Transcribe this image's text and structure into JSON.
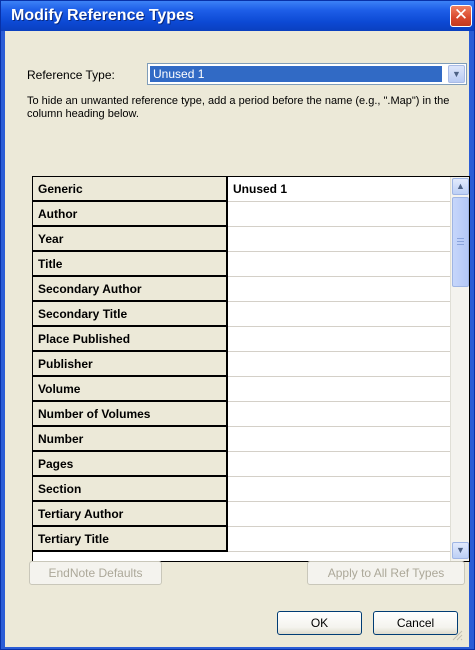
{
  "window": {
    "title": "Modify Reference Types",
    "close_glyph": "✕"
  },
  "reference_type": {
    "label": "Reference Type:",
    "selected": "Unused 1",
    "arrow_glyph": "▼"
  },
  "instructions": "To hide an unwanted reference type, add a period before the name (e.g., \".Map\") in the column heading below.",
  "fields": [
    {
      "label": "Generic",
      "value": "Unused 1"
    },
    {
      "label": "Author",
      "value": ""
    },
    {
      "label": "Year",
      "value": ""
    },
    {
      "label": "Title",
      "value": ""
    },
    {
      "label": "Secondary Author",
      "value": ""
    },
    {
      "label": "Secondary Title",
      "value": ""
    },
    {
      "label": "Place Published",
      "value": ""
    },
    {
      "label": "Publisher",
      "value": ""
    },
    {
      "label": "Volume",
      "value": ""
    },
    {
      "label": "Number of Volumes",
      "value": ""
    },
    {
      "label": "Number",
      "value": ""
    },
    {
      "label": "Pages",
      "value": ""
    },
    {
      "label": "Section",
      "value": ""
    },
    {
      "label": "Tertiary Author",
      "value": ""
    },
    {
      "label": "Tertiary Title",
      "value": ""
    }
  ],
  "scrollbar": {
    "up_glyph": "▲",
    "down_glyph": "▼"
  },
  "buttons": {
    "endnote_defaults": "EndNote Defaults",
    "apply_all": "Apply to All Ref Types",
    "ok": "OK",
    "cancel": "Cancel"
  },
  "colors": {
    "title_bar": "#0c49d4",
    "selection": "#316ac5",
    "dialog_face": "#ece9d8",
    "close_button": "#d8472c"
  }
}
